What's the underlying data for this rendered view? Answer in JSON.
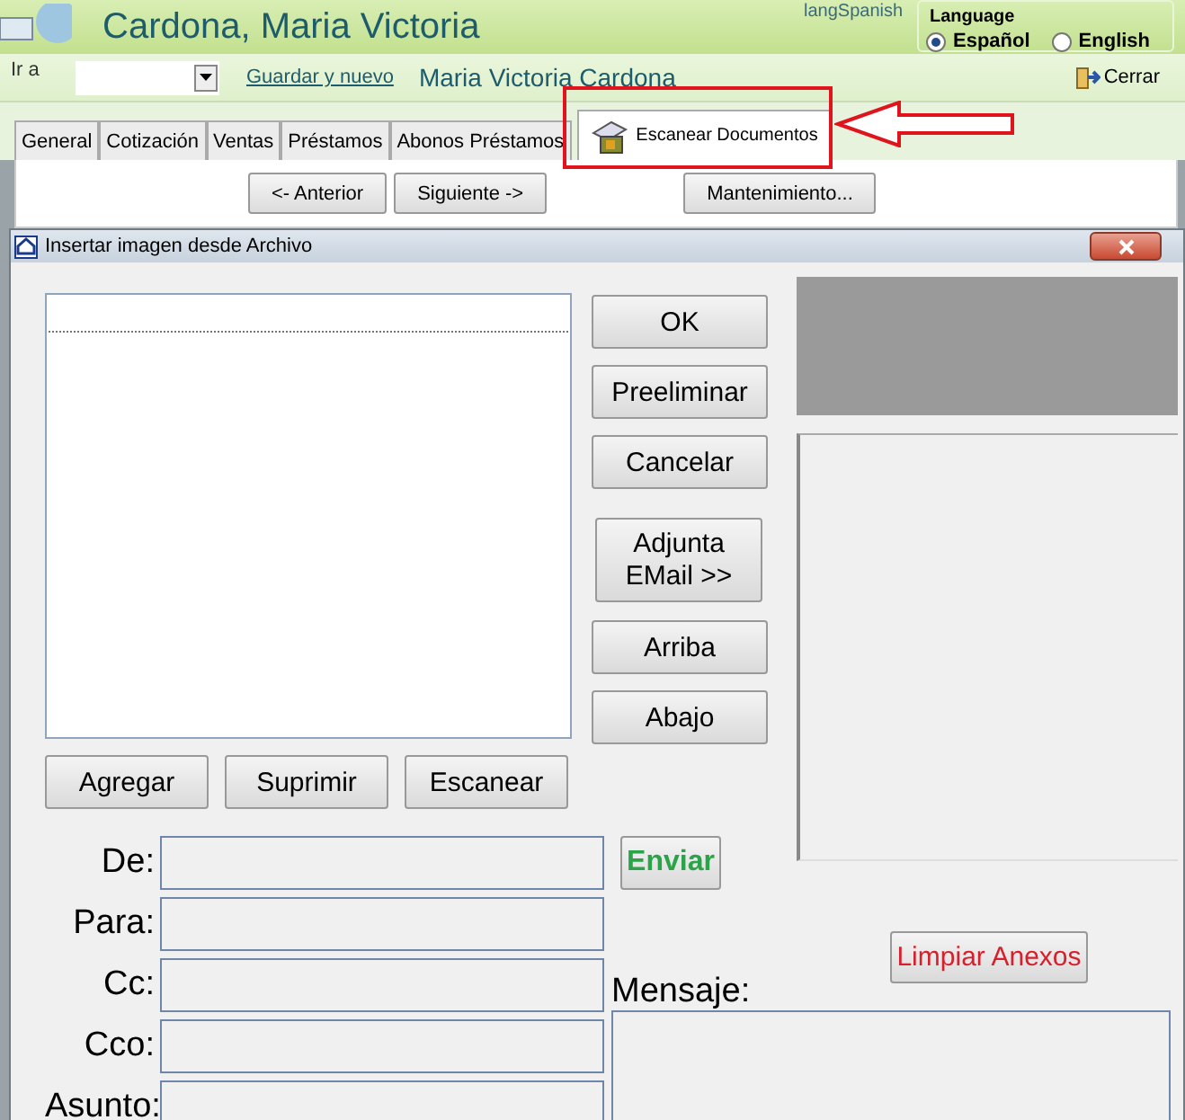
{
  "header": {
    "title": "Cardona, Maria Victoria",
    "lang_label": "langSpanish",
    "language": {
      "legend": "Language",
      "options": [
        {
          "label": "Español",
          "selected": true
        },
        {
          "label": "English",
          "selected": false
        }
      ]
    }
  },
  "toolbar": {
    "goto_label": "Ir a",
    "save_new": "Guardar y nuevo",
    "record_name": "Maria Victoria Cardona",
    "close": "Cerrar"
  },
  "tabs": [
    {
      "label": "General",
      "selected": false
    },
    {
      "label": "Cotización",
      "selected": false
    },
    {
      "label": "Ventas",
      "selected": false
    },
    {
      "label": "Préstamos",
      "selected": false
    },
    {
      "label": "Abonos Préstamos",
      "selected": false
    },
    {
      "label": "Escanear Documentos",
      "selected": true
    }
  ],
  "nav_buttons": [
    "<- Anterior",
    "Siguiente ->",
    "Mantenimiento..."
  ],
  "dialog": {
    "title": "Insertar imagen desde Archivo",
    "side_buttons": [
      "OK",
      "Preeliminar",
      "Cancelar",
      "Adjunta EMail >>",
      "Arriba",
      "Abajo"
    ],
    "list_buttons": [
      "Agregar",
      "Suprimir",
      "Escanear"
    ],
    "fields": [
      {
        "label": "De:"
      },
      {
        "label": "Para:"
      },
      {
        "label": "Cc:"
      },
      {
        "label": "Cco:"
      },
      {
        "label": "Asunto:"
      }
    ],
    "send": "Enviar",
    "clear": "Limpiar Anexos",
    "message_label": "Mensaje:"
  }
}
